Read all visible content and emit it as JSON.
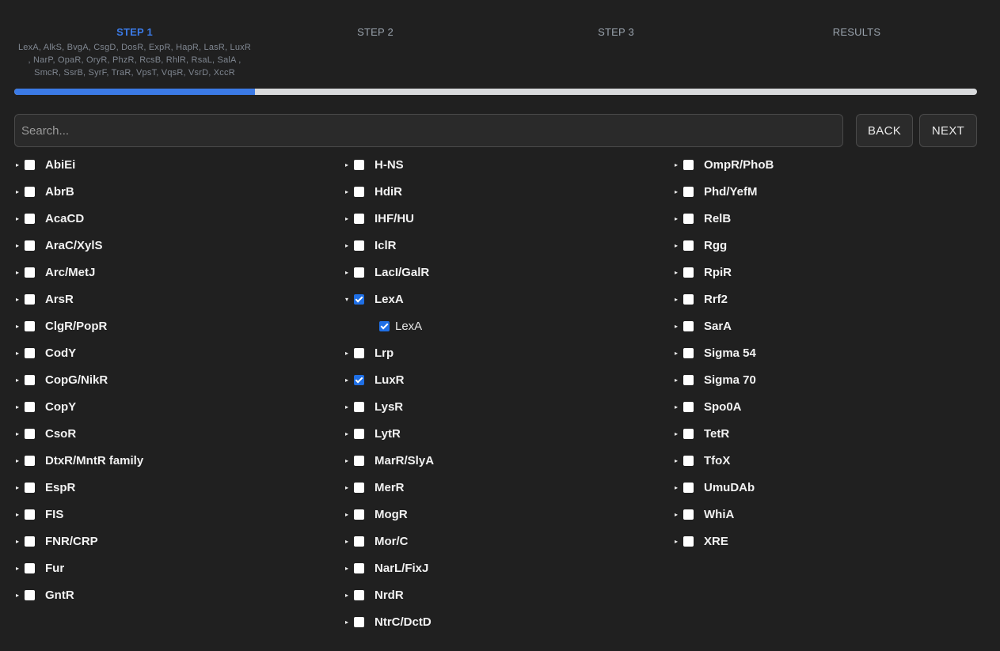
{
  "steps": [
    {
      "title": "STEP 1",
      "summary": "LexA, AlkS, BvgA, CsgD, DosR, ExpR, HapR, LasR, LuxR , NarP, OpaR, OryR, PhzR, RcsB, RhlR, RsaL, SalA , SmcR, SsrB, SyrF, TraR, VpsT, VqsR, VsrD, XccR"
    },
    {
      "title": "STEP 2"
    },
    {
      "title": "STEP 3"
    },
    {
      "title": "RESULTS"
    }
  ],
  "progress": {
    "value": 0.25,
    "accent": "#3b7ae6"
  },
  "search": {
    "placeholder": "Search..."
  },
  "buttons": {
    "back": "BACK",
    "next": "NEXT"
  },
  "columns": [
    [
      {
        "label": "AbiEi"
      },
      {
        "label": "AbrB"
      },
      {
        "label": "AcaCD"
      },
      {
        "label": "AraC/XylS"
      },
      {
        "label": "Arc/MetJ"
      },
      {
        "label": "ArsR"
      },
      {
        "label": "ClgR/PopR"
      },
      {
        "label": "CodY"
      },
      {
        "label": "CopG/NikR"
      },
      {
        "label": "CopY"
      },
      {
        "label": "CsoR"
      },
      {
        "label": "DtxR/MntR family"
      },
      {
        "label": "EspR"
      },
      {
        "label": "FIS"
      },
      {
        "label": "FNR/CRP"
      },
      {
        "label": "Fur"
      },
      {
        "label": "GntR"
      }
    ],
    [
      {
        "label": "H-NS"
      },
      {
        "label": "HdiR"
      },
      {
        "label": "IHF/HU"
      },
      {
        "label": "IclR"
      },
      {
        "label": "LacI/GalR"
      },
      {
        "label": "LexA",
        "checked": true,
        "expanded": true,
        "children": [
          {
            "label": "LexA",
            "checked": true
          }
        ]
      },
      {
        "label": "Lrp"
      },
      {
        "label": "LuxR",
        "checked": true
      },
      {
        "label": "LysR"
      },
      {
        "label": "LytR"
      },
      {
        "label": "MarR/SlyA"
      },
      {
        "label": "MerR"
      },
      {
        "label": "MogR"
      },
      {
        "label": "Mor/C"
      },
      {
        "label": "NarL/FixJ"
      },
      {
        "label": "NrdR"
      },
      {
        "label": "NtrC/DctD"
      }
    ],
    [
      {
        "label": "OmpR/PhoB"
      },
      {
        "label": "Phd/YefM"
      },
      {
        "label": "RelB"
      },
      {
        "label": "Rgg"
      },
      {
        "label": "RpiR"
      },
      {
        "label": "Rrf2"
      },
      {
        "label": "SarA"
      },
      {
        "label": "Sigma 54"
      },
      {
        "label": "Sigma 70"
      },
      {
        "label": "Spo0A"
      },
      {
        "label": "TetR"
      },
      {
        "label": "TfoX"
      },
      {
        "label": "UmuDAb"
      },
      {
        "label": "WhiA"
      },
      {
        "label": "XRE"
      }
    ]
  ],
  "icons": {
    "collapsed": "caret-right-icon",
    "expanded": "caret-down-icon"
  }
}
